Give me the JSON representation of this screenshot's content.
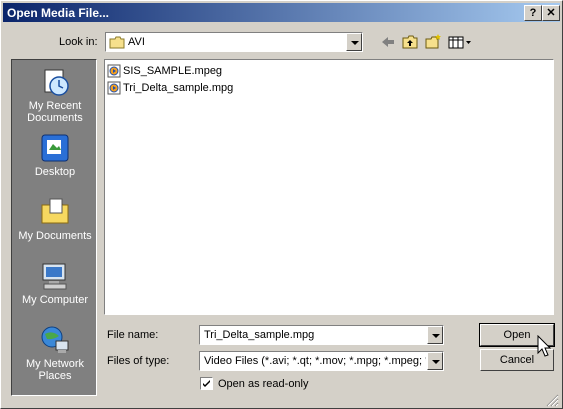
{
  "window": {
    "title": "Open Media File...",
    "help_btn": "?",
    "close_btn": "✕"
  },
  "lookin": {
    "label": "Look in:",
    "value": "AVI"
  },
  "places": [
    {
      "label_line1": "My Recent",
      "label_line2": "Documents",
      "icon": "recent-documents-icon"
    },
    {
      "label_line1": "Desktop",
      "label_line2": "",
      "icon": "desktop-icon"
    },
    {
      "label_line1": "My Documents",
      "label_line2": "",
      "icon": "my-documents-icon"
    },
    {
      "label_line1": "My Computer",
      "label_line2": "",
      "icon": "my-computer-icon"
    },
    {
      "label_line1": "My Network",
      "label_line2": "Places",
      "icon": "network-places-icon"
    }
  ],
  "files": [
    {
      "name": "SIS_SAMPLE.mpeg",
      "icon": "media-file-icon"
    },
    {
      "name": "Tri_Delta_sample.mpg",
      "icon": "media-file-icon"
    }
  ],
  "filename": {
    "label": "File name:",
    "value": "Tri_Delta_sample.mpg"
  },
  "filetype": {
    "label": "Files of type:",
    "value": "Video Files (*.avi; *.qt; *.mov; *.mpg; *.mpeg; *.m"
  },
  "readonly": {
    "label": "Open as read-only",
    "checked": true
  },
  "buttons": {
    "open": "Open",
    "cancel": "Cancel"
  }
}
